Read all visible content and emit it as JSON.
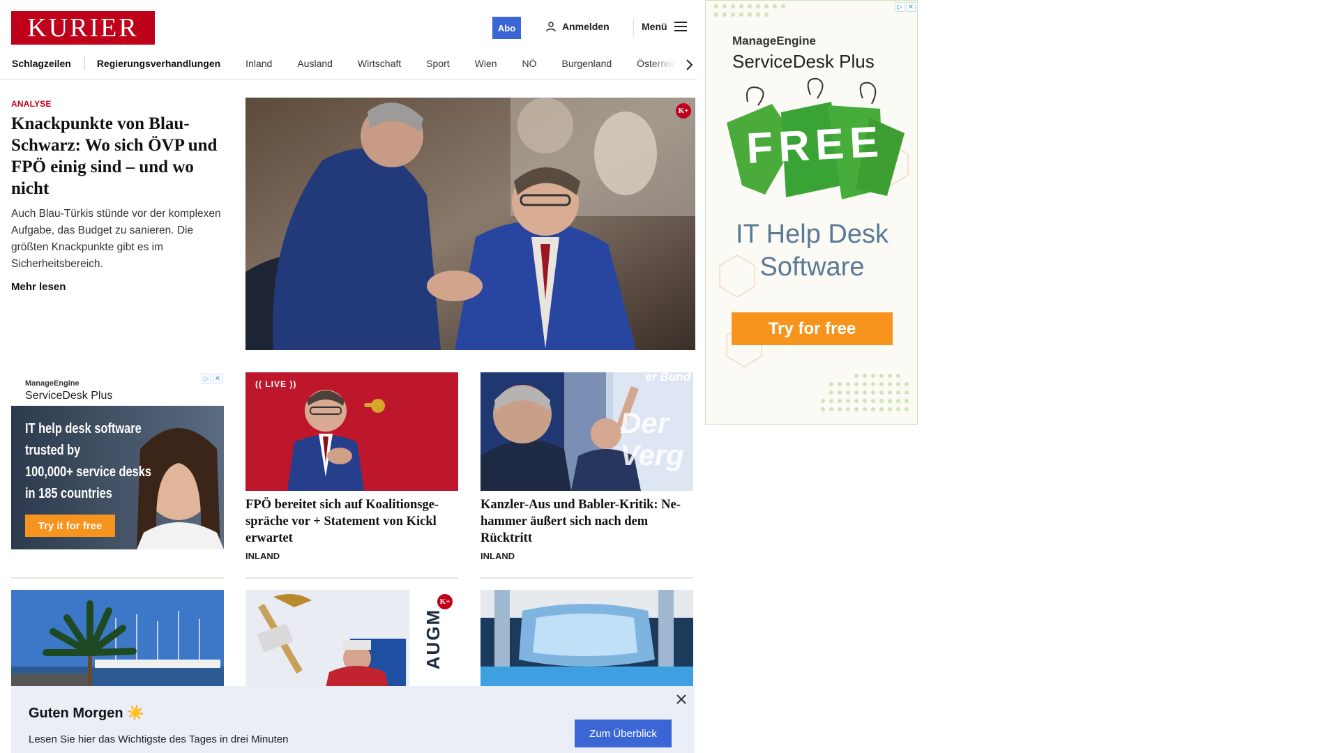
{
  "header": {
    "logo_text": "KURIER",
    "abo_label": "Abo",
    "login_label": "Anmelden",
    "menu_label": "Menü"
  },
  "nav": {
    "items": [
      "Schlagzeilen",
      "Regierungsverhandlungen",
      "Inland",
      "Ausland",
      "Wirtschaft",
      "Sport",
      "Wien",
      "NÖ",
      "Burgenland",
      "Österreich"
    ]
  },
  "hero": {
    "kicker": "Analyse",
    "title": "Knackpunkte von Blau-Schwarz: Wo sich ÖVP und FPÖ einig sind – und wo nicht",
    "description": "Auch Blau-Türkis stünde vor der komplexen Aufgabe, das Budget zu sanieren. Die größten Knackpunkte gibt es im Sicherheitsbereich.",
    "more_label": "Mehr lesen",
    "premium_badge": "K+"
  },
  "ad_small": {
    "brand": "ManageEngine",
    "product": "ServiceDesk Plus",
    "headline": "IT help desk software trusted by 100,000+ service desks in 185 countries",
    "headline_lines": [
      "IT help desk software",
      "trusted by",
      "100,000+ service desks",
      "in 185 countries"
    ],
    "cta": "Try it for free"
  },
  "ad_right": {
    "brand": "ManageEngine",
    "product": "ServiceDesk Plus",
    "tag_text": "FREE",
    "headline_lines": [
      "IT Help Desk",
      "Software"
    ],
    "cta": "Try for free"
  },
  "cards": [
    {
      "badge": "LIVE",
      "title": "FPÖ bereitet sich auf Koalitionsge­spräche vor + Statement von Kickl erwartet",
      "category": "Inland"
    },
    {
      "overlay_text": "er Bund",
      "overlay_big": "Der Verg",
      "title": "Kanzler-Aus und Babler-Kritik: Ne­hammer äußert sich nach dem Rücktritt",
      "category": "Inland"
    }
  ],
  "row2": {
    "premium_badge": "K+",
    "sign_text": "AUGM"
  },
  "banner": {
    "title": "Guten Morgen ☀️",
    "subtitle": "Lesen Sie hier das Wichtigste des Tages in drei Minuten",
    "button": "Zum Überblick"
  },
  "colors": {
    "brand_red": "#c0001a",
    "accent_blue": "#3a66d6",
    "banner_bg": "#e9eef7",
    "ad_orange": "#f7941d",
    "ad_green": "#3aa335"
  }
}
